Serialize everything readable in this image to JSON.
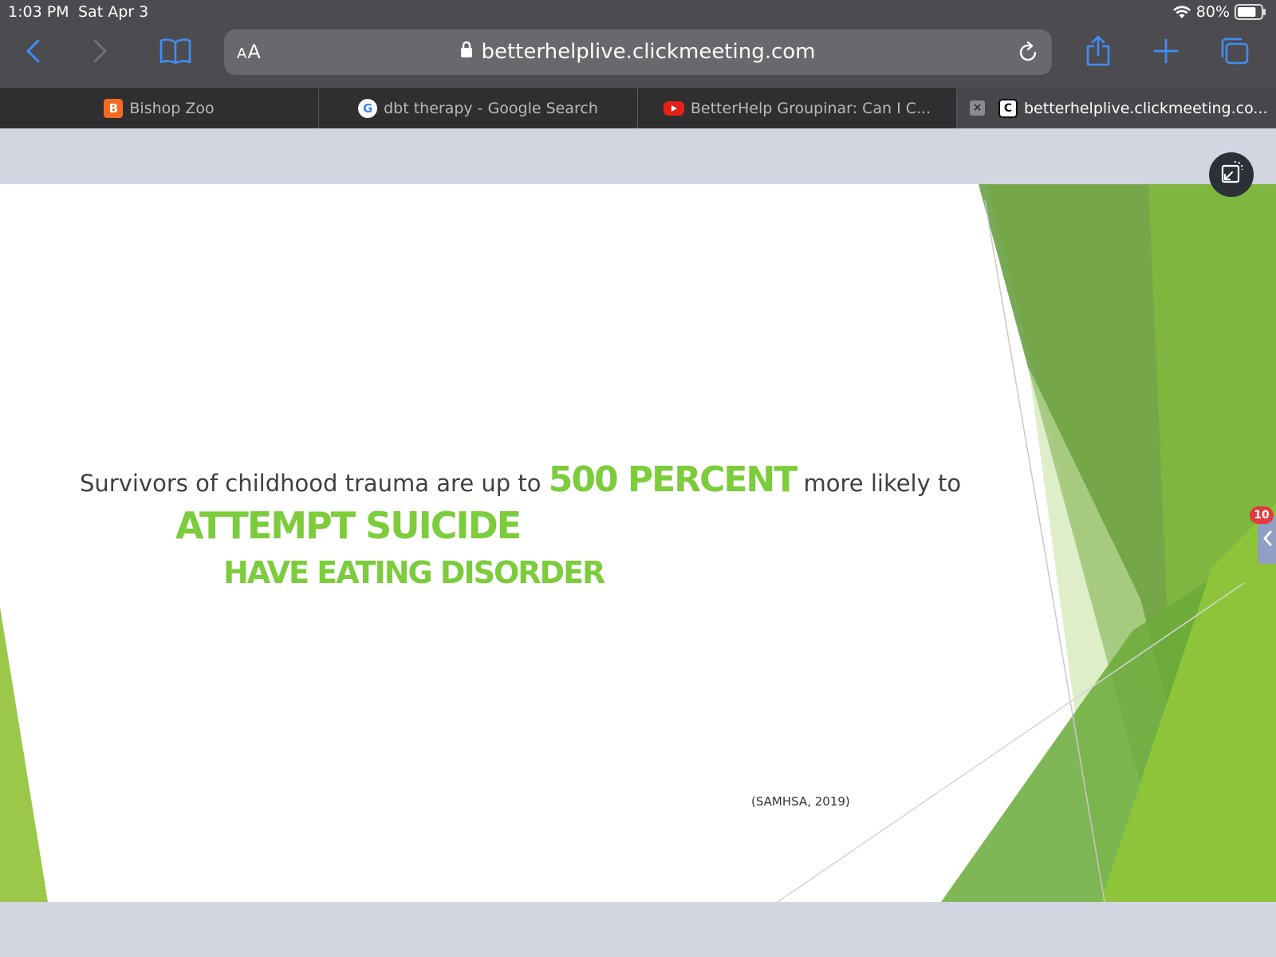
{
  "status_bar": {
    "time": "1:03 PM",
    "date": "Sat Apr 3",
    "battery": "80%",
    "battery_level": 0.8
  },
  "toolbar": {
    "text_size_label_small": "A",
    "text_size_label_large": "A",
    "url": "betterhelplive.clickmeeting.com",
    "icons": [
      "chevron-left-icon",
      "chevron-right-icon",
      "book-icon",
      "lock-icon",
      "reload-icon",
      "share-icon",
      "plus-icon",
      "tabs-icon"
    ]
  },
  "tabs": [
    {
      "title": "Bishop Zoo",
      "favicon": "B",
      "active": false
    },
    {
      "title": "dbt therapy - Google Search",
      "favicon": "G",
      "active": false
    },
    {
      "title": "BetterHelp Groupinar: Can I C...",
      "favicon": "",
      "active": false
    },
    {
      "title": "betterhelplive.clickmeeting.co...",
      "favicon": "C",
      "active": true,
      "close": "×"
    }
  ],
  "slide": {
    "line1_pre": "Survivors of childhood trauma are up to",
    "line1_highlight": "500 PERCENT",
    "line1_post": "more likely to",
    "line2": "ATTEMPT SUICIDE",
    "line3": "HAVE EATING DISORDER",
    "citation": "(SAMHSA, 2019)",
    "accent_color": "#7ccc3c"
  },
  "sidebar": {
    "badge_count": "10"
  }
}
